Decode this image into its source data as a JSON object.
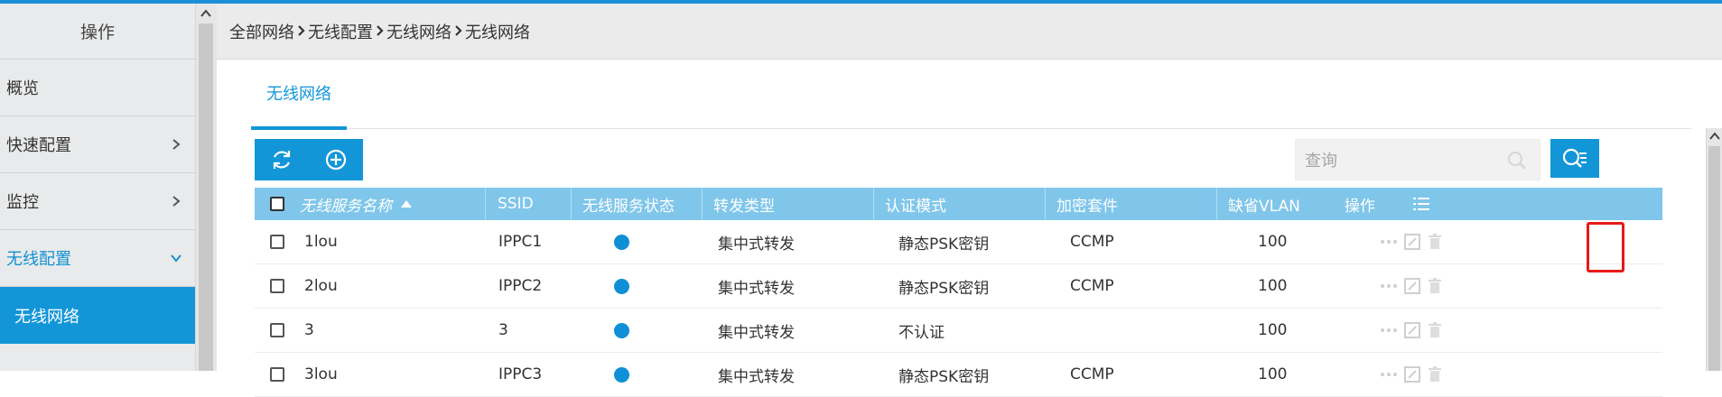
{
  "sidebar": {
    "title": "操作",
    "items": [
      {
        "label": "概览"
      },
      {
        "label": "快速配置"
      },
      {
        "label": "监控"
      },
      {
        "label": "无线配置"
      },
      {
        "label": "无线网络"
      }
    ]
  },
  "breadcrumb": [
    "全部网络",
    "无线配置",
    "无线网络",
    "无线网络"
  ],
  "tabs": [
    {
      "label": "无线网络"
    }
  ],
  "search": {
    "placeholder": "查询"
  },
  "table": {
    "headers": {
      "name": "无线服务名称",
      "ssid": "SSID",
      "status": "无线服务状态",
      "forward": "转发类型",
      "auth": "认证模式",
      "cipher": "加密套件",
      "vlan": "缺省VLAN",
      "action": "操作"
    },
    "rows": [
      {
        "name": "1lou",
        "ssid": "IPPC1",
        "forward": "集中式转发",
        "auth": "静态PSK密钥",
        "cipher": "CCMP",
        "vlan": "100"
      },
      {
        "name": "2lou",
        "ssid": "IPPC2",
        "forward": "集中式转发",
        "auth": "静态PSK密钥",
        "cipher": "CCMP",
        "vlan": "100"
      },
      {
        "name": "3",
        "ssid": "3",
        "forward": "集中式转发",
        "auth": "不认证",
        "cipher": "",
        "vlan": "100"
      },
      {
        "name": "3lou",
        "ssid": "IPPC3",
        "forward": "集中式转发",
        "auth": "静态PSK密钥",
        "cipher": "CCMP",
        "vlan": "100"
      }
    ]
  },
  "colors": {
    "accent": "#1396d8",
    "header_bg": "#7fc6ea",
    "status_dot": "#0f8fd6",
    "highlight": "#e61919"
  }
}
